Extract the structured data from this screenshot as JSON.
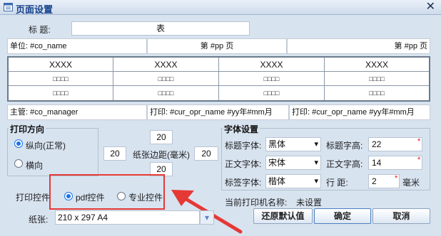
{
  "window": {
    "title": "页面设置",
    "close_glyph": "✕"
  },
  "title_field": {
    "label": "标    题:",
    "value": "表"
  },
  "header_row": {
    "unit": "单位: #co_name",
    "page_center": "第 #pp 页",
    "page_right": "第 #pp 页"
  },
  "grid": {
    "headers": [
      "XXXX",
      "XXXX",
      "XXXX",
      "XXXX"
    ],
    "rows": [
      [
        "□□□□",
        "□□□□",
        "□□□□",
        "□□□□"
      ],
      [
        "□□□□",
        "□□□□",
        "□□□□",
        "□□□□"
      ]
    ]
  },
  "footer_row": {
    "manager": "主管: #co_manager",
    "print1": "打印: #cur_opr_name  #yy年#mm月",
    "print2": "打印: #cur_opr_name  #yy年#mm月"
  },
  "orientation": {
    "legend": "打印方向",
    "portrait": "纵向(正常)",
    "landscape": "横向"
  },
  "margins": {
    "top": "20",
    "left": "20",
    "right": "20",
    "bottom": "20",
    "label": "纸张边距(毫米)"
  },
  "font": {
    "legend": "字体设置",
    "title_font_label": "标题字体:",
    "title_font": "黑体",
    "title_height_label": "标题字高:",
    "title_height": "22",
    "body_font_label": "正文字体:",
    "body_font": "宋体",
    "body_height_label": "正文字高:",
    "body_height": "14",
    "tag_font_label": "标签字体:",
    "tag_font": "楷体",
    "line_spacing_label": "行    距:",
    "line_spacing": "2",
    "unit": "毫米"
  },
  "print_control": {
    "label": "打印控件",
    "pdf": "pdf控件",
    "pro": "专业控件"
  },
  "printer": {
    "label": "当前打印机名称:",
    "value": "未设置"
  },
  "paper": {
    "label": "纸张:",
    "value": "210 x 297 A4"
  },
  "buttons": {
    "restore": "还原默认值",
    "ok": "确定",
    "cancel": "取消"
  },
  "colors": {
    "highlight_box": "#e53935",
    "arrow": "#e53935",
    "accent": "#1a73e8"
  }
}
